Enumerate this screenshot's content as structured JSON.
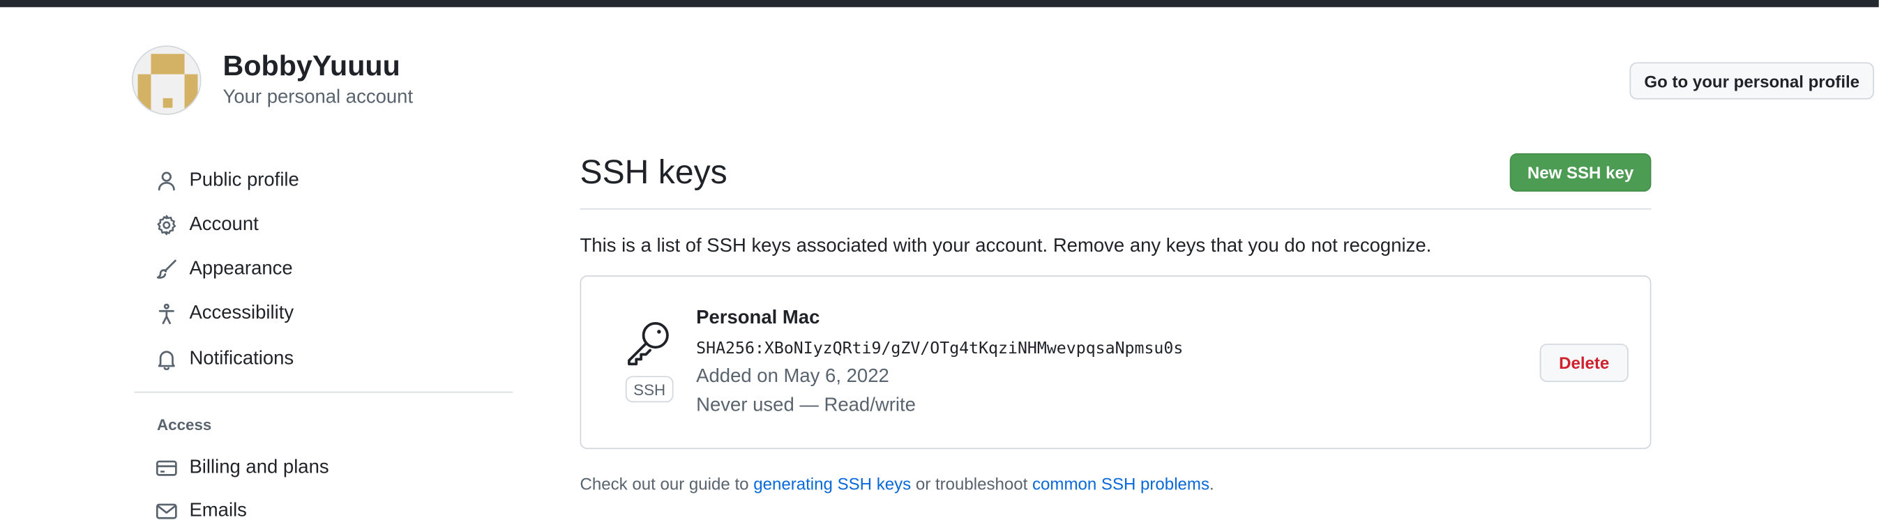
{
  "colors": {
    "top_bar": "#24292f",
    "primary_button": "#4c9c54",
    "danger_text": "#cf222e",
    "link": "#0969da",
    "muted_text": "#59636e",
    "avatar_gold": "#d3b266"
  },
  "account": {
    "name": "BobbyYuuuu",
    "subtitle": "Your personal account",
    "profile_button": "Go to your personal profile"
  },
  "sidebar": {
    "items": [
      {
        "label": "Public profile",
        "icon": "person-icon"
      },
      {
        "label": "Account",
        "icon": "gear-icon"
      },
      {
        "label": "Appearance",
        "icon": "paintbrush-icon"
      },
      {
        "label": "Accessibility",
        "icon": "accessibility-icon"
      },
      {
        "label": "Notifications",
        "icon": "bell-icon"
      }
    ],
    "access_heading": "Access",
    "access_items": [
      {
        "label": "Billing and plans",
        "icon": "credit-card-icon"
      },
      {
        "label": "Emails",
        "icon": "mail-icon"
      }
    ]
  },
  "main": {
    "title": "SSH keys",
    "new_key_button": "New SSH key",
    "intro": "This is a list of SSH keys associated with your account. Remove any keys that you do not recognize.",
    "keys": [
      {
        "title": "Personal Mac",
        "fingerprint": "SHA256:XBoNIyzQRti9/gZV/OTg4tKqziNHMwevpqsaNpmsu0s",
        "added": "Added on May 6, 2022",
        "usage": "Never used — Read/write",
        "type_label": "SSH",
        "icon": "key-icon",
        "delete_label": "Delete"
      }
    ],
    "footer": {
      "prefix": "Check out our guide to ",
      "link1": "generating SSH keys",
      "middle": " or troubleshoot ",
      "link2": "common SSH problems",
      "suffix": "."
    }
  }
}
